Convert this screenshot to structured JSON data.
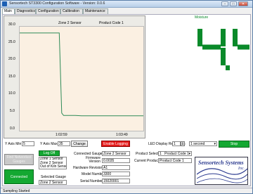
{
  "window": {
    "title": "Sensortech ST3300 Configuration Software - Version: 0.0.6",
    "minimize": "–",
    "maximize": "□",
    "close": "✕"
  },
  "tabs": [
    "Main",
    "Diagnostics",
    "Configuration",
    "Calibration",
    "Maintenance"
  ],
  "chart": {
    "header_left": "Zone 2 Sensor",
    "header_right": "Product Code 1",
    "y_ticks": [
      "30.0",
      "25.0",
      "20.0",
      "15.0",
      "10.0",
      "5.0",
      "0.0"
    ],
    "x_ticks": [
      "1:02:59",
      "1:03:49"
    ]
  },
  "chart_data": {
    "type": "line",
    "title": "",
    "xlabel": "",
    "ylabel": "",
    "ylim": [
      0,
      30
    ],
    "x": [
      "1:02:59",
      "",
      "",
      "",
      "1:03:49"
    ],
    "series": [
      {
        "name": "",
        "color": "#2e8b57",
        "values": [
          {
            "t": 0.0,
            "v": 28.2
          },
          {
            "t": 0.32,
            "v": 28.2
          },
          {
            "t": 0.34,
            "v": 5.1
          },
          {
            "t": 0.355,
            "v": 4.4
          },
          {
            "t": 0.45,
            "v": 4.4
          },
          {
            "t": 0.5,
            "v": 4.3
          },
          {
            "t": 1.0,
            "v": 4.3
          }
        ]
      }
    ]
  },
  "axis_controls": {
    "y_min_label": "Y Axis Min",
    "y_min_value": "5",
    "y_max_label": "Y Axis Max",
    "y_max_value": "35",
    "change": "Change",
    "enable_logging": "Enable Logging"
  },
  "moisture": {
    "label": "Moisture",
    "value": "4.4",
    "color": "#0a8a2a"
  },
  "led": {
    "label": "LED Display Resolution",
    "value": "1",
    "interval": "1 second",
    "stop": "Stop"
  },
  "left_controls": {
    "find_network": "Find Networked Gauges",
    "log_off": "Log Off",
    "connected": "Connected",
    "gauge_list": [
      "Zone 1 Sensor",
      "Zone 2 Sensor",
      "Out of Kiln Sensor"
    ],
    "selected_gauge_label": "Selected Gauge",
    "selected_gauge_value": "Zone 2 Sensor"
  },
  "gauge_info": {
    "connected_gauge_label": "Connected Gauge",
    "connected_gauge_value": "Zone 2 Sensor",
    "firmware_label": "Firmware Version",
    "firmware_value": "0.0035",
    "hardware_label": "Hardware Revision",
    "hardware_value": "A1",
    "model_label": "Model Number",
    "model_value": "3300",
    "serial_label": "Serial Number",
    "serial_value": "15020001"
  },
  "product": {
    "select_label": "Product Select",
    "select_value": "1",
    "select_code": "Product Code 1",
    "current_label": "Current Product",
    "current_value": "Product Code 1"
  },
  "logo": {
    "line1": "Sensortech Systems",
    "line2": "Inc."
  },
  "status": {
    "text": "Sampling Started"
  }
}
